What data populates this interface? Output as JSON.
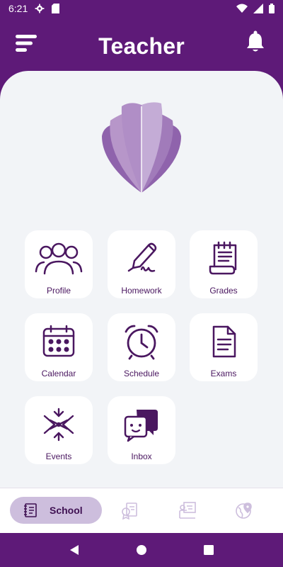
{
  "status_bar": {
    "time": "6:21"
  },
  "header": {
    "title": "Teacher"
  },
  "tiles": [
    {
      "label": "Profile",
      "icon": "people-group-icon"
    },
    {
      "label": "Homework",
      "icon": "pen-signature-icon"
    },
    {
      "label": "Grades",
      "icon": "scroll-icon"
    },
    {
      "label": "Calendar",
      "icon": "calendar-icon"
    },
    {
      "label": "Schedule",
      "icon": "alarm-clock-icon"
    },
    {
      "label": "Exams",
      "icon": "document-icon"
    },
    {
      "label": "Events",
      "icon": "star-burst-icon"
    },
    {
      "label": "Inbox",
      "icon": "chat-bubbles-icon"
    }
  ],
  "bottom_nav": {
    "active_label": "School",
    "items": [
      "school-notebook-icon",
      "certificate-icon",
      "teacher-board-icon",
      "globe-pin-icon"
    ]
  },
  "colors": {
    "primary": "#5e1a78",
    "accent_light": "#cdbedd",
    "background": "#f2f4f7"
  }
}
